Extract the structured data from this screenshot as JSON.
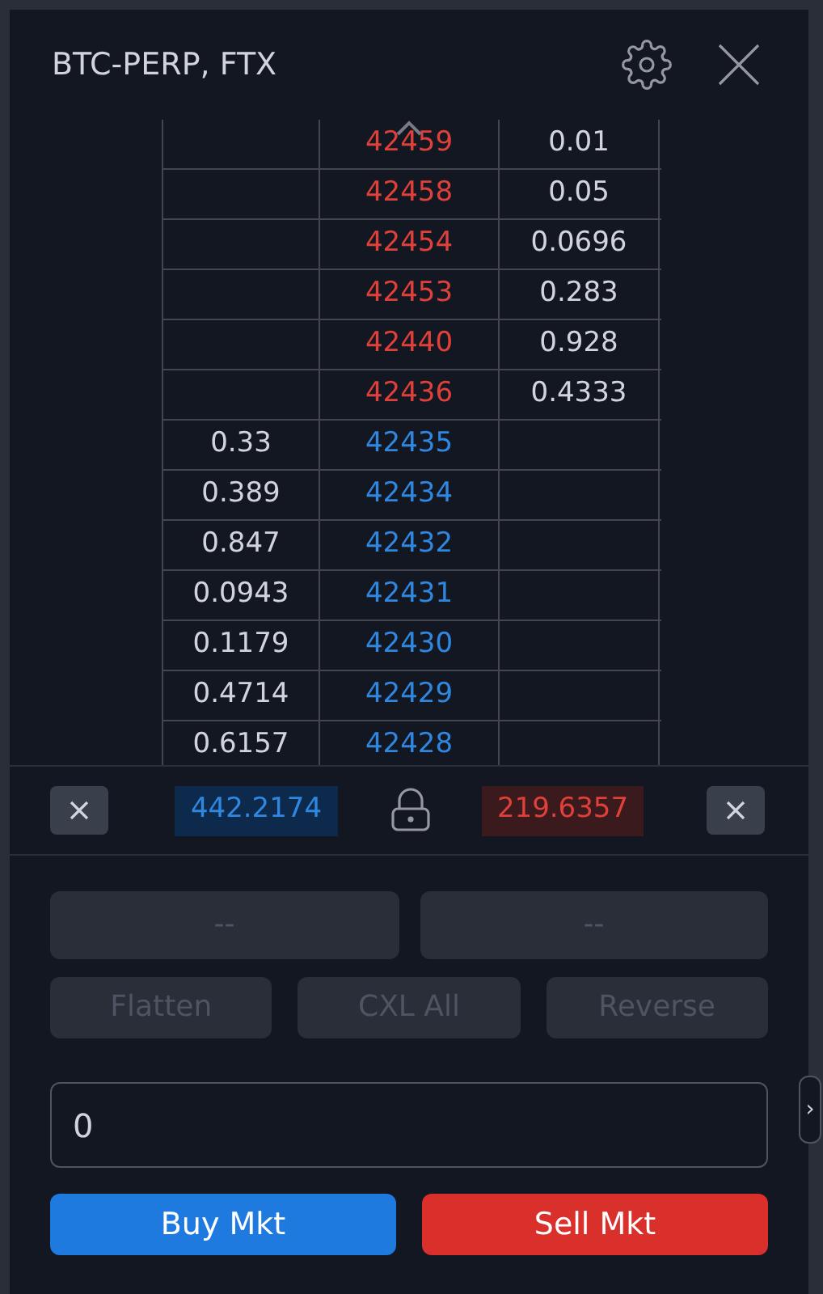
{
  "window": {
    "title": "BTC-PERP, FTX"
  },
  "order_book": {
    "rows": [
      {
        "kind": "ask",
        "bid_size": "",
        "price": "42459",
        "ask_size": "0.01"
      },
      {
        "kind": "ask",
        "bid_size": "",
        "price": "42458",
        "ask_size": "0.05"
      },
      {
        "kind": "ask",
        "bid_size": "",
        "price": "42454",
        "ask_size": "0.0696"
      },
      {
        "kind": "ask",
        "bid_size": "",
        "price": "42453",
        "ask_size": "0.283"
      },
      {
        "kind": "ask",
        "bid_size": "",
        "price": "42440",
        "ask_size": "0.928"
      },
      {
        "kind": "ask",
        "bid_size": "",
        "price": "42436",
        "ask_size": "0.4333"
      },
      {
        "kind": "bid",
        "bid_size": "0.33",
        "price": "42435",
        "ask_size": ""
      },
      {
        "kind": "bid",
        "bid_size": "0.389",
        "price": "42434",
        "ask_size": ""
      },
      {
        "kind": "bid",
        "bid_size": "0.847",
        "price": "42432",
        "ask_size": ""
      },
      {
        "kind": "bid",
        "bid_size": "0.0943",
        "price": "42431",
        "ask_size": ""
      },
      {
        "kind": "bid",
        "bid_size": "0.1179",
        "price": "42430",
        "ask_size": ""
      },
      {
        "kind": "bid",
        "bid_size": "0.4714",
        "price": "42429",
        "ask_size": ""
      },
      {
        "kind": "bid",
        "bid_size": "0.6157",
        "price": "42428",
        "ask_size": ""
      }
    ]
  },
  "totals": {
    "bid_total": "442.2174",
    "ask_total": "219.6357"
  },
  "button_rows": [
    [
      {
        "label": "--",
        "disabled": true
      },
      {
        "label": "--",
        "disabled": true
      }
    ],
    [
      {
        "label": "Flatten",
        "disabled": true
      },
      {
        "label": "CXL All",
        "disabled": true
      },
      {
        "label": "Reverse",
        "disabled": true
      }
    ]
  ],
  "quantity": {
    "value": "0"
  },
  "actions": [
    {
      "label": "Buy Mkt",
      "kind": "buy"
    },
    {
      "label": "Sell Mkt",
      "kind": "sell"
    }
  ],
  "collapse_handle": "›"
}
